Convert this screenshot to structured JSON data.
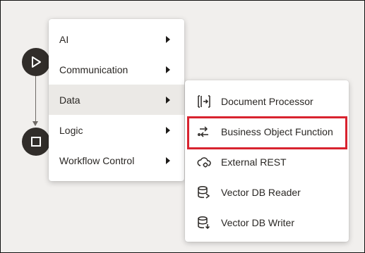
{
  "primary_menu": {
    "items": [
      {
        "label": "AI",
        "has_submenu": true
      },
      {
        "label": "Communication",
        "has_submenu": true
      },
      {
        "label": "Data",
        "has_submenu": true,
        "active": true
      },
      {
        "label": "Logic",
        "has_submenu": true
      },
      {
        "label": "Workflow Control",
        "has_submenu": true
      }
    ]
  },
  "data_submenu": {
    "items": [
      {
        "label": "Document Processor",
        "icon": "document-processor-icon"
      },
      {
        "label": "Business Object Function",
        "icon": "business-object-function-icon",
        "highlighted": true
      },
      {
        "label": "External REST",
        "icon": "external-rest-icon"
      },
      {
        "label": "Vector DB Reader",
        "icon": "vector-db-reader-icon"
      },
      {
        "label": "Vector DB Writer",
        "icon": "vector-db-writer-icon"
      }
    ]
  },
  "nodes": {
    "start_icon": "play-icon",
    "stop_icon": "stop-icon"
  },
  "colors": {
    "node_fill": "#312d2a",
    "active_item_bg": "#ebe9e6",
    "highlight_border": "#d8232f",
    "canvas_bg": "#f1efed"
  }
}
